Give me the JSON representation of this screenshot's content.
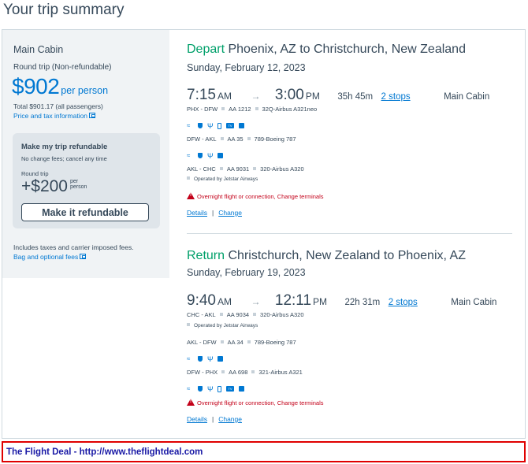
{
  "page_title": "Your trip summary",
  "sidebar": {
    "cabin": "Main Cabin",
    "trip_type": "Round trip (Non-refundable)",
    "price": "$902",
    "price_unit": "per person",
    "total": "Total $901.17 (all passengers)",
    "price_info_link": "Price and tax information",
    "refund": {
      "title": "Make my trip refundable",
      "subtitle": "No change fees; cancel any time",
      "trip_label": "Round trip",
      "price": "+$200",
      "per_line1": "per",
      "per_line2": "person",
      "button": "Make it refundable"
    },
    "taxes_note": "Includes taxes and carrier imposed fees.",
    "bag_link": "Bag and optional fees"
  },
  "depart": {
    "kind": "Depart",
    "route": "Phoenix, AZ to Christchurch, New Zealand",
    "date": "Sunday, February 12, 2023",
    "dep_time": "7:15",
    "dep_ampm": "AM",
    "arrow": "→",
    "arr_time": "3:00",
    "arr_ampm": "PM",
    "duration": "35h 45m",
    "stops": "2 stops",
    "cabin": "Main Cabin",
    "segments": [
      {
        "route": "PHX - DFW",
        "flight": "AA 1212",
        "aircraft": "32Q-Airbus A321neo"
      },
      {
        "route": "DFW - AKL",
        "flight": "AA 35",
        "aircraft": "789-Boeing 787"
      },
      {
        "route": "AKL - CHC",
        "flight": "AA 9031",
        "aircraft": "320-Airbus A320"
      }
    ],
    "operated_by": "Operated by Jetstar Airways",
    "warning": "Overnight flight or connection, Change terminals",
    "details": "Details",
    "change": "Change",
    "separator": "|"
  },
  "return": {
    "kind": "Return",
    "route": "Christchurch, New Zealand to Phoenix, AZ",
    "date": "Sunday, February 19, 2023",
    "dep_time": "9:40",
    "dep_ampm": "AM",
    "arrow": "→",
    "arr_time": "12:11",
    "arr_ampm": "PM",
    "duration": "22h 31m",
    "stops": "2 stops",
    "cabin": "Main Cabin",
    "segments": [
      {
        "route": "CHC - AKL",
        "flight": "AA 9034",
        "aircraft": "320-Airbus A320"
      },
      {
        "route": "AKL - DFW",
        "flight": "AA 34",
        "aircraft": "789-Boeing 787"
      },
      {
        "route": "DFW - PHX",
        "flight": "AA 698",
        "aircraft": "321-Airbus A321"
      }
    ],
    "operated_by": "Operated by Jetstar Airways",
    "warning": "Overnight flight or connection, Change terminals",
    "details": "Details",
    "change": "Change",
    "separator": "|"
  },
  "amenity_icons": [
    "wifi-icon",
    "power-icon",
    "usb-icon",
    "phone-icon",
    "tv-icon",
    "wireless-entertainment-icon"
  ],
  "colors": {
    "accent": "#0078d2",
    "depart_return": "#00a06a",
    "warning": "#c30019",
    "text": "#36495a"
  },
  "footer": "The Flight Deal - http://www.theflightdeal.com"
}
